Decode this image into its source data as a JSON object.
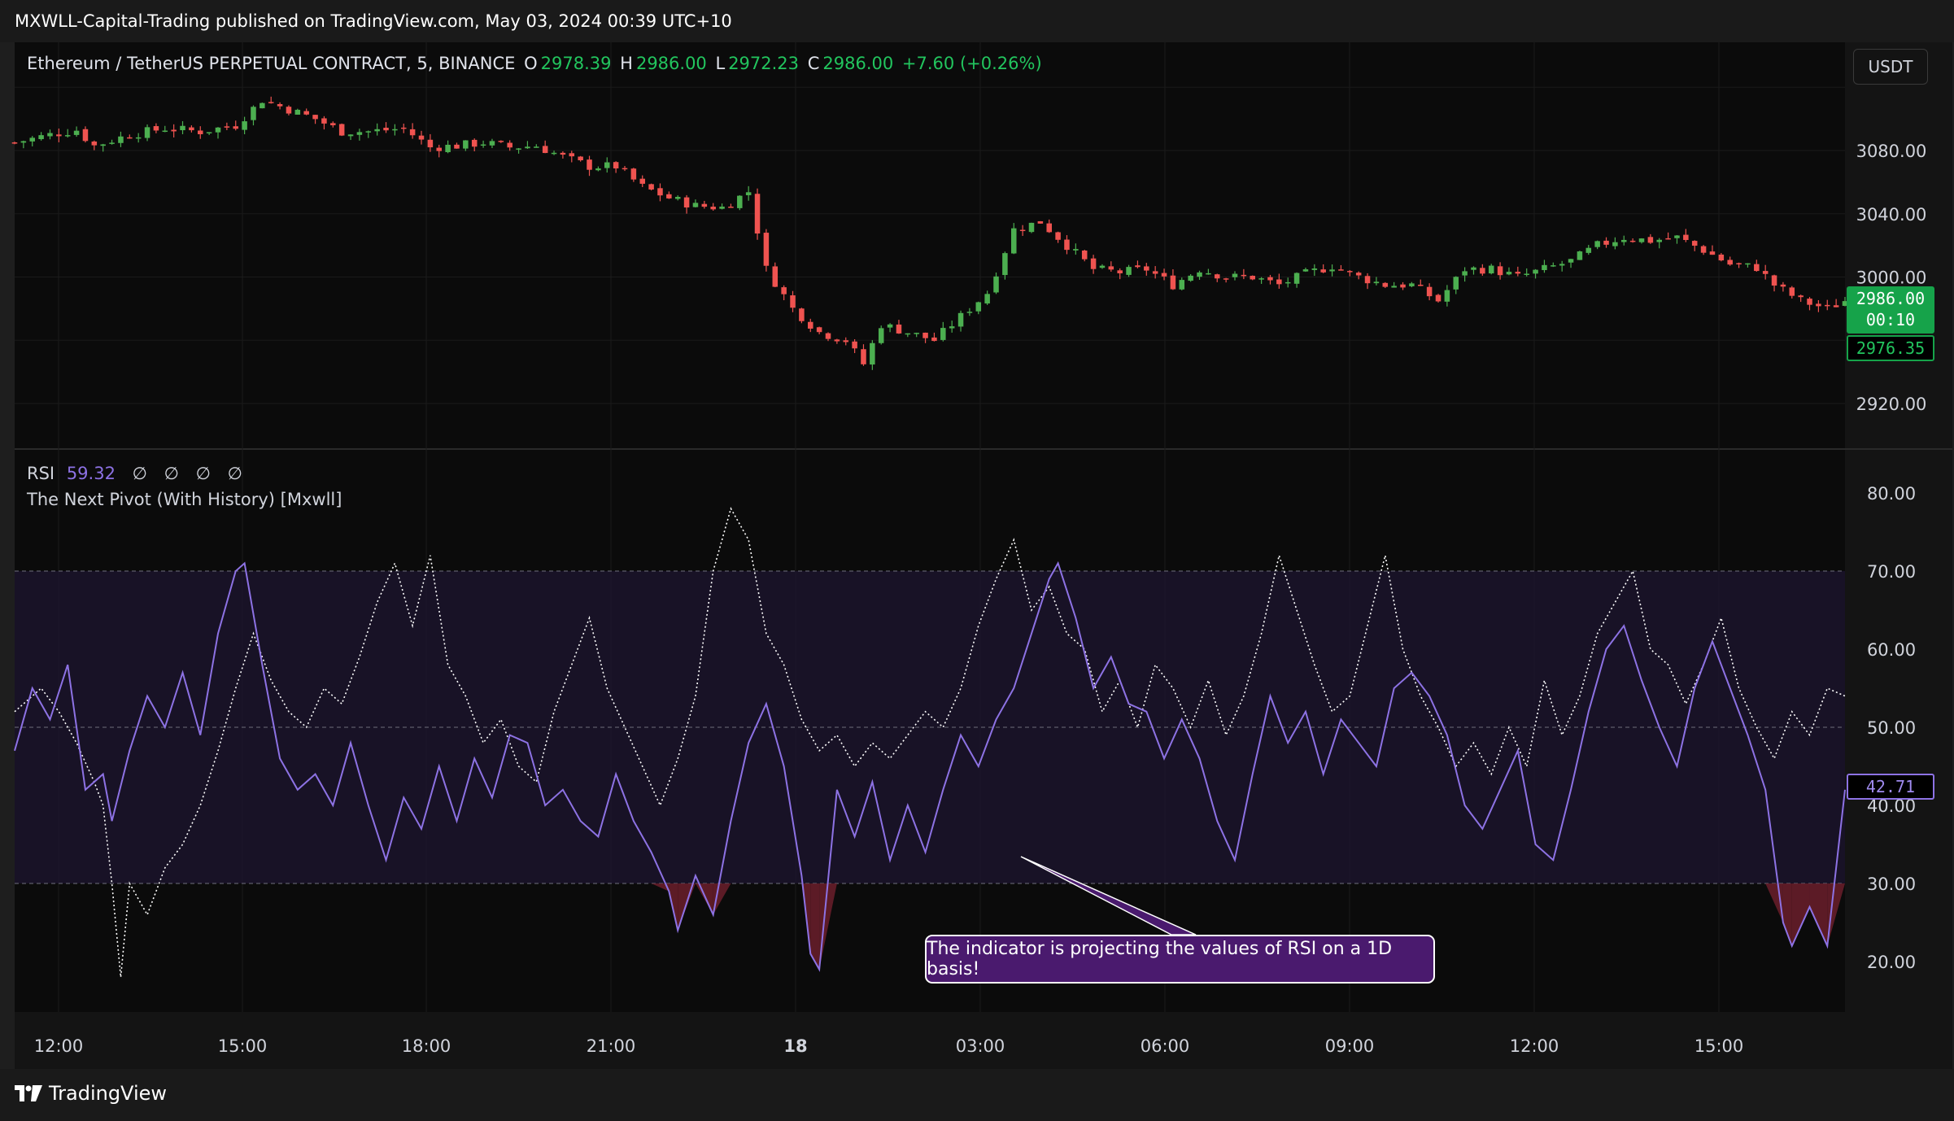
{
  "publisher": "MXWLL-Capital-Trading published on TradingView.com, May 03, 2024 00:39 UTC+10",
  "symbol": {
    "name": "Ethereum / TetherUS PERPETUAL CONTRACT, 5, BINANCE",
    "o_label": "O",
    "o": "2978.39",
    "h_label": "H",
    "h": "2986.00",
    "l_label": "L",
    "l": "2972.23",
    "c_label": "C",
    "c": "2986.00",
    "change": "+7.60 (+0.26%)"
  },
  "currency_button": "USDT",
  "price_tags": {
    "last": "2986.00",
    "countdown": "00:10",
    "secondary": "2976.35"
  },
  "rsi_legend": {
    "label": "RSI",
    "value": "59.32",
    "nulls": [
      "∅",
      "∅",
      "∅",
      "∅"
    ],
    "indicator_name": "The Next Pivot (With History) [Mxwll]",
    "last_tag": "42.71"
  },
  "annotation": "The indicator is projecting the values of RSI on a 1D basis!",
  "footer_logo": "TradingView",
  "colors": {
    "up": "#22ab94",
    "down": "#f23645",
    "up_candle": "#4caf50",
    "down_candle": "#ef5350",
    "rsi": "#8d72e4",
    "projection": "#ffffff",
    "band": "#1d1530",
    "oversold_fill": "#6b1f2b",
    "annotation_bg": "#4a1a6e",
    "price_tag": "#16a34a"
  },
  "chart_data": [
    {
      "type": "candlestick",
      "x_ticks": [
        "12:00",
        "15:00",
        "18:00",
        "21:00",
        "18",
        "03:00",
        "06:00",
        "09:00",
        "12:00",
        "15:00"
      ],
      "y_ticks": [
        "3080.00",
        "3040.00",
        "3000.00",
        "2920.00"
      ],
      "ylim": [
        2912,
        3120
      ],
      "close_path": [
        [
          0,
          3085
        ],
        [
          4,
          3090
        ],
        [
          7,
          3093
        ],
        [
          9,
          3083
        ],
        [
          13,
          3090
        ],
        [
          17,
          3094
        ],
        [
          21,
          3092
        ],
        [
          25,
          3096
        ],
        [
          28,
          3112
        ],
        [
          31,
          3106
        ],
        [
          34,
          3100
        ],
        [
          37,
          3092
        ],
        [
          40,
          3092
        ],
        [
          44,
          3094
        ],
        [
          47,
          3082
        ],
        [
          50,
          3083
        ],
        [
          53,
          3085
        ],
        [
          56,
          3082
        ],
        [
          59,
          3083
        ],
        [
          62,
          3076
        ],
        [
          65,
          3070
        ],
        [
          68,
          3070
        ],
        [
          71,
          3057
        ],
        [
          74,
          3050
        ],
        [
          77,
          3045
        ],
        [
          80,
          3044
        ],
        [
          83,
          3054
        ],
        [
          85,
          3005
        ],
        [
          88,
          2980
        ],
        [
          91,
          2965
        ],
        [
          94,
          2960
        ],
        [
          96,
          2945
        ],
        [
          98,
          2970
        ],
        [
          101,
          2965
        ],
        [
          104,
          2960
        ],
        [
          107,
          2975
        ],
        [
          110,
          2990
        ],
        [
          113,
          3030
        ],
        [
          116,
          3035
        ],
        [
          119,
          3020
        ],
        [
          122,
          3005
        ],
        [
          125,
          3003
        ],
        [
          128,
          3005
        ],
        [
          131,
          2995
        ],
        [
          134,
          3005
        ],
        [
          137,
          3000
        ],
        [
          140,
          3000
        ],
        [
          143,
          2995
        ],
        [
          146,
          3002
        ],
        [
          149,
          3007
        ],
        [
          152,
          3000
        ],
        [
          155,
          2995
        ],
        [
          158,
          2995
        ],
        [
          161,
          2985
        ],
        [
          164,
          3005
        ],
        [
          167,
          3005
        ],
        [
          170,
          3000
        ],
        [
          173,
          3005
        ],
        [
          176,
          3010
        ],
        [
          179,
          3020
        ],
        [
          182,
          3025
        ],
        [
          185,
          3023
        ],
        [
          188,
          3025
        ],
        [
          191,
          3017
        ],
        [
          194,
          3008
        ],
        [
          197,
          3006
        ],
        [
          199,
          2995
        ],
        [
          202,
          2985
        ],
        [
          205,
          2980
        ],
        [
          207,
          2985
        ]
      ]
    },
    {
      "type": "line",
      "x_ticks": [
        "12:00",
        "15:00",
        "18:00",
        "21:00",
        "18",
        "03:00",
        "06:00",
        "09:00",
        "12:00",
        "15:00"
      ],
      "y_ticks": [
        "80.00",
        "70.00",
        "60.00",
        "50.00",
        "40.00",
        "30.00",
        "20.00"
      ],
      "ylim": [
        16,
        84
      ],
      "bands": {
        "upper": 70,
        "mid": 50,
        "lower": 30
      },
      "series": [
        {
          "name": "RSI",
          "values": [
            [
              0,
              47
            ],
            [
              2,
              55
            ],
            [
              4,
              51
            ],
            [
              6,
              58
            ],
            [
              8,
              42
            ],
            [
              10,
              44
            ],
            [
              11,
              38
            ],
            [
              13,
              47
            ],
            [
              15,
              54
            ],
            [
              17,
              50
            ],
            [
              19,
              57
            ],
            [
              21,
              49
            ],
            [
              23,
              62
            ],
            [
              25,
              70
            ],
            [
              26,
              71
            ],
            [
              28,
              58
            ],
            [
              30,
              46
            ],
            [
              32,
              42
            ],
            [
              34,
              44
            ],
            [
              36,
              40
            ],
            [
              38,
              48
            ],
            [
              40,
              40
            ],
            [
              42,
              33
            ],
            [
              44,
              41
            ],
            [
              46,
              37
            ],
            [
              48,
              45
            ],
            [
              50,
              38
            ],
            [
              52,
              46
            ],
            [
              54,
              41
            ],
            [
              56,
              49
            ],
            [
              58,
              48
            ],
            [
              60,
              40
            ],
            [
              62,
              42
            ],
            [
              64,
              38
            ],
            [
              66,
              36
            ],
            [
              68,
              44
            ],
            [
              70,
              38
            ],
            [
              72,
              34
            ],
            [
              74,
              29
            ],
            [
              75,
              24
            ],
            [
              77,
              31
            ],
            [
              79,
              26
            ],
            [
              81,
              38
            ],
            [
              83,
              48
            ],
            [
              85,
              53
            ],
            [
              87,
              45
            ],
            [
              89,
              31
            ],
            [
              90,
              21
            ],
            [
              91,
              19
            ],
            [
              93,
              42
            ],
            [
              95,
              36
            ],
            [
              97,
              43
            ],
            [
              99,
              33
            ],
            [
              101,
              40
            ],
            [
              103,
              34
            ],
            [
              105,
              42
            ],
            [
              107,
              49
            ],
            [
              109,
              45
            ],
            [
              111,
              51
            ],
            [
              113,
              55
            ],
            [
              115,
              62
            ],
            [
              117,
              69
            ],
            [
              118,
              71
            ],
            [
              120,
              64
            ],
            [
              122,
              55
            ],
            [
              124,
              59
            ],
            [
              126,
              53
            ],
            [
              128,
              52
            ],
            [
              130,
              46
            ],
            [
              132,
              51
            ],
            [
              134,
              46
            ],
            [
              136,
              38
            ],
            [
              138,
              33
            ],
            [
              140,
              44
            ],
            [
              142,
              54
            ],
            [
              144,
              48
            ],
            [
              146,
              52
            ],
            [
              148,
              44
            ],
            [
              150,
              51
            ],
            [
              152,
              48
            ],
            [
              154,
              45
            ],
            [
              156,
              55
            ],
            [
              158,
              57
            ],
            [
              160,
              54
            ],
            [
              162,
              49
            ],
            [
              164,
              40
            ],
            [
              166,
              37
            ],
            [
              168,
              42
            ],
            [
              170,
              47
            ],
            [
              172,
              35
            ],
            [
              174,
              33
            ],
            [
              176,
              42
            ],
            [
              178,
              52
            ],
            [
              180,
              60
            ],
            [
              182,
              63
            ],
            [
              184,
              56
            ],
            [
              186,
              50
            ],
            [
              188,
              45
            ],
            [
              190,
              55
            ],
            [
              192,
              61
            ],
            [
              194,
              55
            ],
            [
              196,
              49
            ],
            [
              198,
              42
            ],
            [
              200,
              25
            ],
            [
              201,
              22
            ],
            [
              203,
              27
            ],
            [
              205,
              22
            ],
            [
              207,
              42
            ]
          ]
        },
        {
          "name": "1D projection",
          "values": [
            [
              0,
              52
            ],
            [
              3,
              55
            ],
            [
              5,
              52
            ],
            [
              7,
              48
            ],
            [
              9,
              43
            ],
            [
              10,
              40
            ],
            [
              11,
              30
            ],
            [
              12,
              18
            ],
            [
              13,
              30
            ],
            [
              15,
              26
            ],
            [
              17,
              32
            ],
            [
              19,
              35
            ],
            [
              21,
              40
            ],
            [
              23,
              47
            ],
            [
              25,
              55
            ],
            [
              27,
              62
            ],
            [
              29,
              56
            ],
            [
              31,
              52
            ],
            [
              33,
              50
            ],
            [
              35,
              55
            ],
            [
              37,
              53
            ],
            [
              39,
              59
            ],
            [
              41,
              66
            ],
            [
              43,
              71
            ],
            [
              45,
              63
            ],
            [
              47,
              72
            ],
            [
              49,
              58
            ],
            [
              51,
              54
            ],
            [
              53,
              48
            ],
            [
              55,
              51
            ],
            [
              57,
              45
            ],
            [
              59,
              43
            ],
            [
              61,
              52
            ],
            [
              63,
              58
            ],
            [
              65,
              64
            ],
            [
              67,
              55
            ],
            [
              69,
              50
            ],
            [
              71,
              45
            ],
            [
              73,
              40
            ],
            [
              75,
              46
            ],
            [
              77,
              54
            ],
            [
              79,
              70
            ],
            [
              81,
              78
            ],
            [
              83,
              74
            ],
            [
              85,
              62
            ],
            [
              87,
              58
            ],
            [
              89,
              51
            ],
            [
              91,
              47
            ],
            [
              93,
              49
            ],
            [
              95,
              45
            ],
            [
              97,
              48
            ],
            [
              99,
              46
            ],
            [
              101,
              49
            ],
            [
              103,
              52
            ],
            [
              105,
              50
            ],
            [
              107,
              55
            ],
            [
              109,
              63
            ],
            [
              111,
              69
            ],
            [
              113,
              74
            ],
            [
              115,
              65
            ],
            [
              117,
              68
            ],
            [
              119,
              62
            ],
            [
              121,
              60
            ],
            [
              123,
              52
            ],
            [
              125,
              56
            ],
            [
              127,
              50
            ],
            [
              129,
              58
            ],
            [
              131,
              55
            ],
            [
              133,
              50
            ],
            [
              135,
              56
            ],
            [
              137,
              49
            ],
            [
              139,
              54
            ],
            [
              141,
              62
            ],
            [
              143,
              72
            ],
            [
              145,
              65
            ],
            [
              147,
              58
            ],
            [
              149,
              52
            ],
            [
              151,
              54
            ],
            [
              153,
              63
            ],
            [
              155,
              72
            ],
            [
              157,
              60
            ],
            [
              159,
              54
            ],
            [
              161,
              50
            ],
            [
              163,
              45
            ],
            [
              165,
              48
            ],
            [
              167,
              44
            ],
            [
              169,
              50
            ],
            [
              171,
              45
            ],
            [
              173,
              56
            ],
            [
              175,
              49
            ],
            [
              177,
              54
            ],
            [
              179,
              62
            ],
            [
              181,
              66
            ],
            [
              183,
              70
            ],
            [
              185,
              60
            ],
            [
              187,
              58
            ],
            [
              189,
              53
            ],
            [
              191,
              58
            ],
            [
              193,
              64
            ],
            [
              195,
              55
            ],
            [
              197,
              50
            ],
            [
              199,
              46
            ],
            [
              201,
              52
            ],
            [
              203,
              49
            ],
            [
              205,
              55
            ],
            [
              207,
              54
            ]
          ]
        }
      ]
    }
  ]
}
